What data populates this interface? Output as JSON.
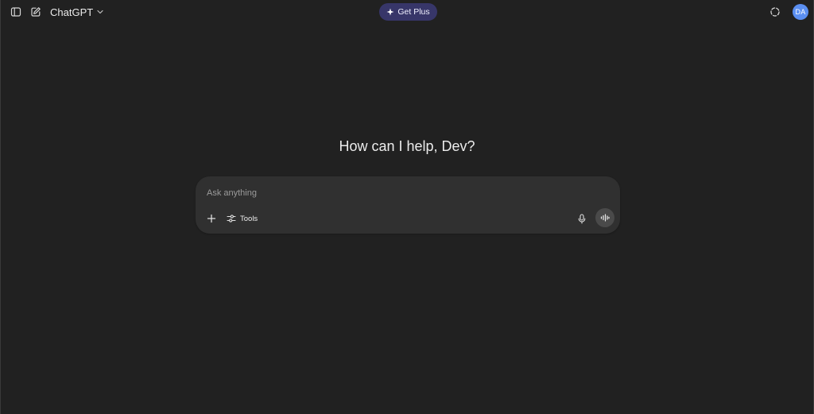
{
  "header": {
    "sidebar_toggle_icon": "sidebar-panel-icon",
    "new_chat_icon": "edit-pencil-icon",
    "model_label": "ChatGPT",
    "model_chevron_icon": "chevron-down-icon",
    "upgrade": {
      "label": "Get Plus",
      "icon": "sparkle-icon",
      "color": "#373669"
    },
    "temporary_chat_icon": "dashed-circle-icon",
    "avatar": {
      "initials": "DA",
      "color": "#5b8ff2"
    }
  },
  "main": {
    "greeting": "How can I help, Dev?",
    "composer": {
      "placeholder": "Ask anything",
      "attach_icon": "plus-icon",
      "tools_label": "Tools",
      "tools_icon": "sliders-icon",
      "mic_icon": "microphone-icon",
      "voice_icon": "voice-waveform-icon"
    }
  },
  "colors": {
    "background": "#212121",
    "composer": "#303030",
    "text": "#ececec",
    "placeholder": "#9b9b9b"
  }
}
